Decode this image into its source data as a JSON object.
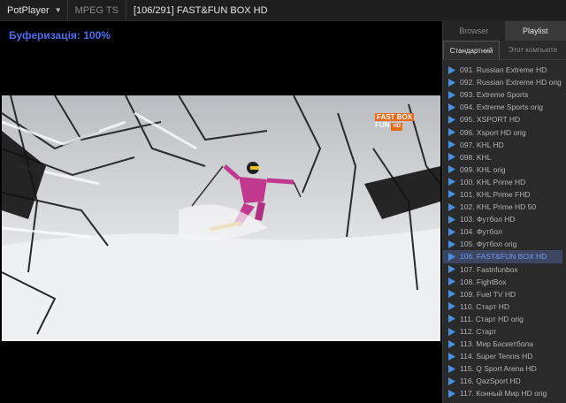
{
  "titlebar": {
    "app_name": "PotPlayer",
    "format": "MPEG TS",
    "title": "[106/291] FAST&FUN BOX HD"
  },
  "video": {
    "buffering_text": "Буферизація: 100%",
    "logo_text": "FAST BOX",
    "logo_sub": "FUN",
    "logo_hd": "HD"
  },
  "panel": {
    "tabs": [
      "Browser",
      "Playlist"
    ],
    "active_tab": "Playlist",
    "subtabs": [
      "Стандартний",
      "Этот компьюте"
    ]
  },
  "playlist": {
    "selected_index": 15,
    "items": [
      "091. Russian Extreme HD",
      "092. Russian Extreme HD orig",
      "093. Extreme Sports",
      "094. Extreme Sports orig",
      "095. XSPORT HD",
      "096. Xsport HD orig",
      "097. KHL HD",
      "098. KHL",
      "099. KHL orig",
      "100. KHL Prime HD",
      "101. KHL Prime FHD",
      "102. KHL Prime HD 50",
      "103. Футбол HD",
      "104. Футбол",
      "105. Футбол orig",
      "106. FAST&FUN BOX HD",
      "107. Fastnfunbox",
      "108. FightBox",
      "109. Fuel TV HD",
      "110. Старт HD",
      "111. Старт HD orig",
      "112. Старт",
      "113. Мир Баскетбола",
      "114. Super Tennis HD",
      "115. Q Sport Arena HD",
      "116. QazSport HD",
      "117. Конный Мир HD orig"
    ]
  },
  "colors": {
    "accent": "#4c6cf0",
    "selected_text": "#6f9cf5",
    "play_icon": "#4a90e2"
  }
}
